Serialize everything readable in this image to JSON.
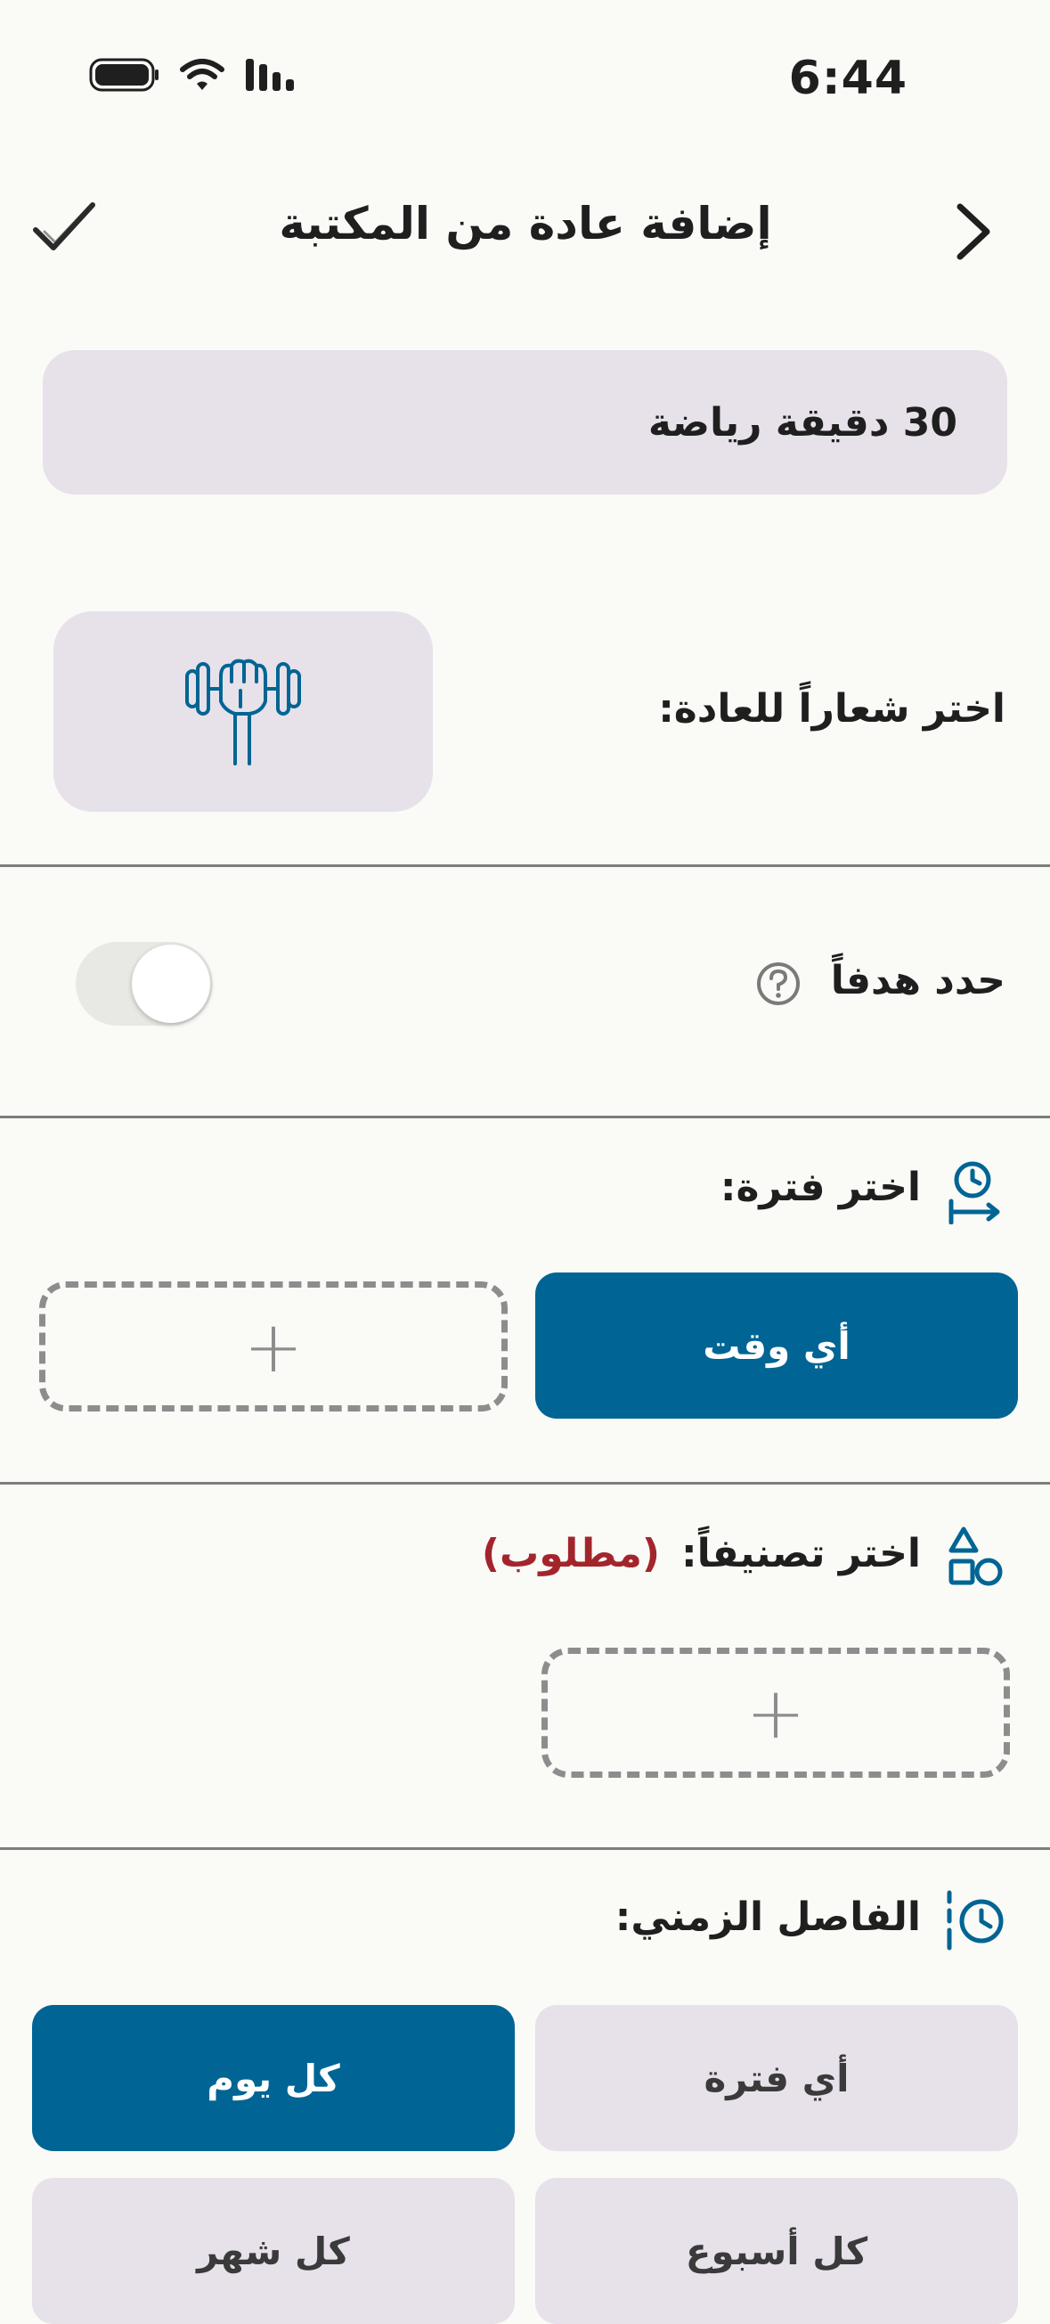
{
  "status_bar": {
    "time": "6:44",
    "icons": [
      "battery-icon",
      "wifi-icon",
      "signal-icon"
    ]
  },
  "header": {
    "title": "إضافة عادة من المكتبة",
    "back_icon": "chevron-right-icon",
    "confirm_icon": "checkmark-icon"
  },
  "habit": {
    "name": "30 دقيقة رياضة"
  },
  "icon_section": {
    "label": "اختر شعاراً للعادة:",
    "selected_icon": "dumbbell-fist-icon"
  },
  "goal_section": {
    "label": "حدد هدفاً",
    "help_icon": "question-icon",
    "toggle_on": false
  },
  "period_section": {
    "label": "اختر فترة:",
    "icon": "clock-arrow-icon",
    "selected": "أي وقت",
    "add_symbol": "+"
  },
  "category_section": {
    "label": "اختر تصنيفاً:",
    "required": "(مطلوب)",
    "icon": "shapes-icon",
    "add_symbol": "+"
  },
  "interval_section": {
    "label": "الفاصل الزمني:",
    "icon": "clock-interval-icon",
    "options": [
      "أي فترة",
      "كل يوم",
      "كل أسبوع",
      "كل شهر"
    ],
    "selected": "كل يوم"
  },
  "colors": {
    "primary": "#006594",
    "light": "#e7e1ea",
    "required": "#a3252c",
    "background": "#fafaf7"
  }
}
